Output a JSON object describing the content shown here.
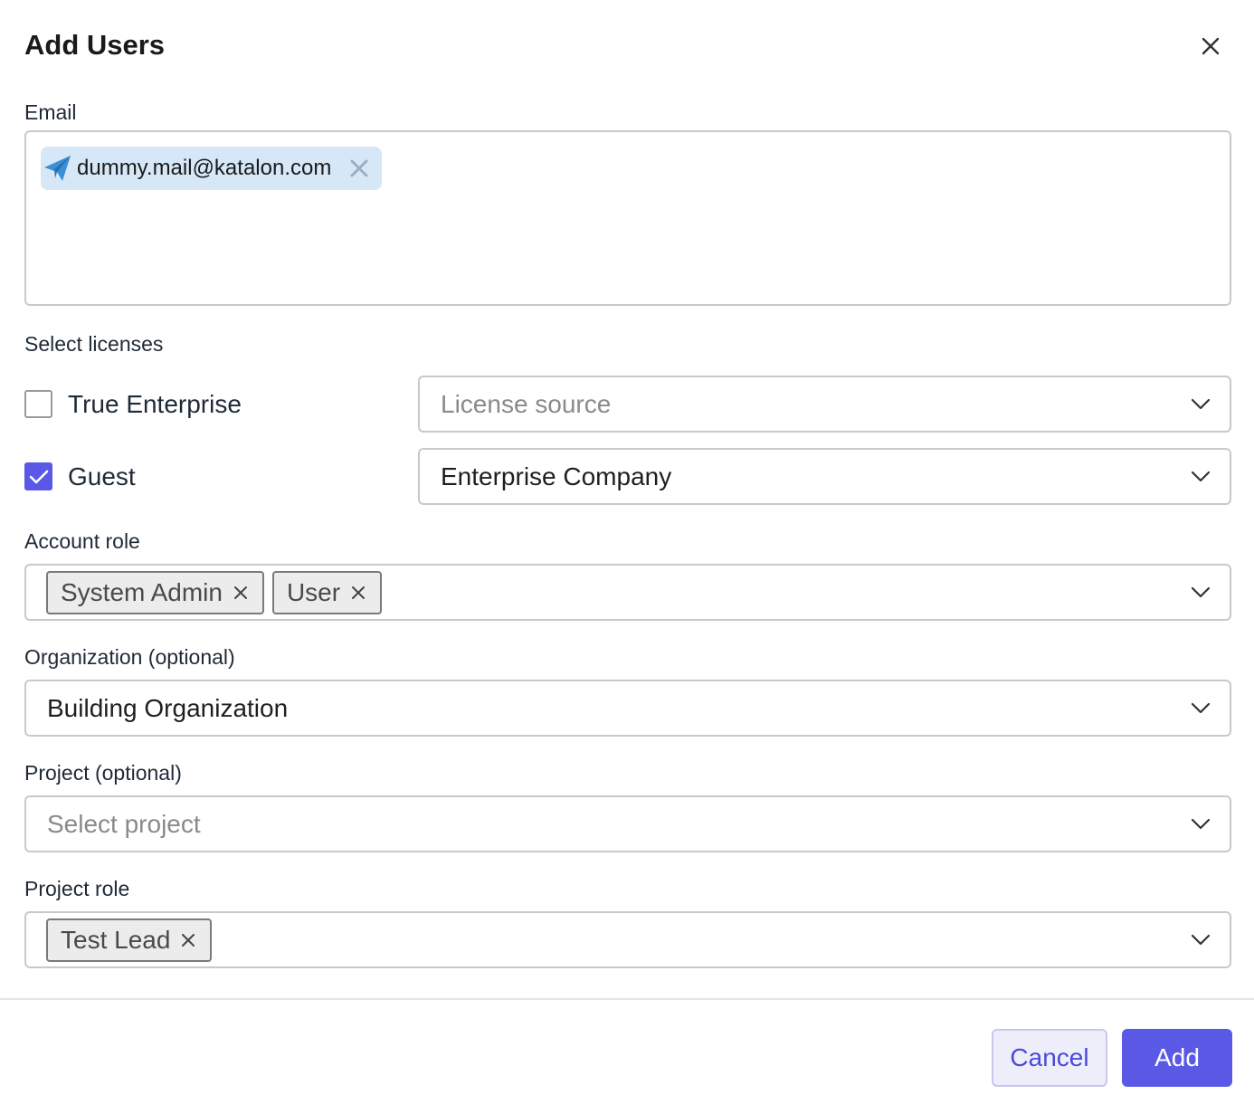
{
  "dialog": {
    "title": "Add Users"
  },
  "email": {
    "label": "Email",
    "chips": [
      "dummy.mail@katalon.com"
    ]
  },
  "licenses": {
    "label": "Select licenses",
    "items": [
      {
        "label": "True Enterprise",
        "checked": false,
        "source": "License source",
        "source_is_placeholder": true
      },
      {
        "label": "Guest",
        "checked": true,
        "source": "Enterprise Company",
        "source_is_placeholder": false
      }
    ]
  },
  "account_role": {
    "label": "Account role",
    "tags": [
      "System Admin",
      "User"
    ]
  },
  "organization": {
    "label": "Organization (optional)",
    "value": "Building Organization"
  },
  "project": {
    "label": "Project (optional)",
    "placeholder": "Select project"
  },
  "project_role": {
    "label": "Project role",
    "tags": [
      "Test Lead"
    ]
  },
  "footer": {
    "cancel_label": "Cancel",
    "add_label": "Add"
  },
  "colors": {
    "accent": "#5959e6",
    "chip_bg": "#d6e8f7",
    "tag_bg": "#ececec",
    "border": "#c9c9c9"
  },
  "icons": {
    "close": "close-icon",
    "email_chip": "paper-plane-icon",
    "dropdown": "chevron-down-icon",
    "remove": "remove-x-icon",
    "check": "checkmark-icon"
  }
}
